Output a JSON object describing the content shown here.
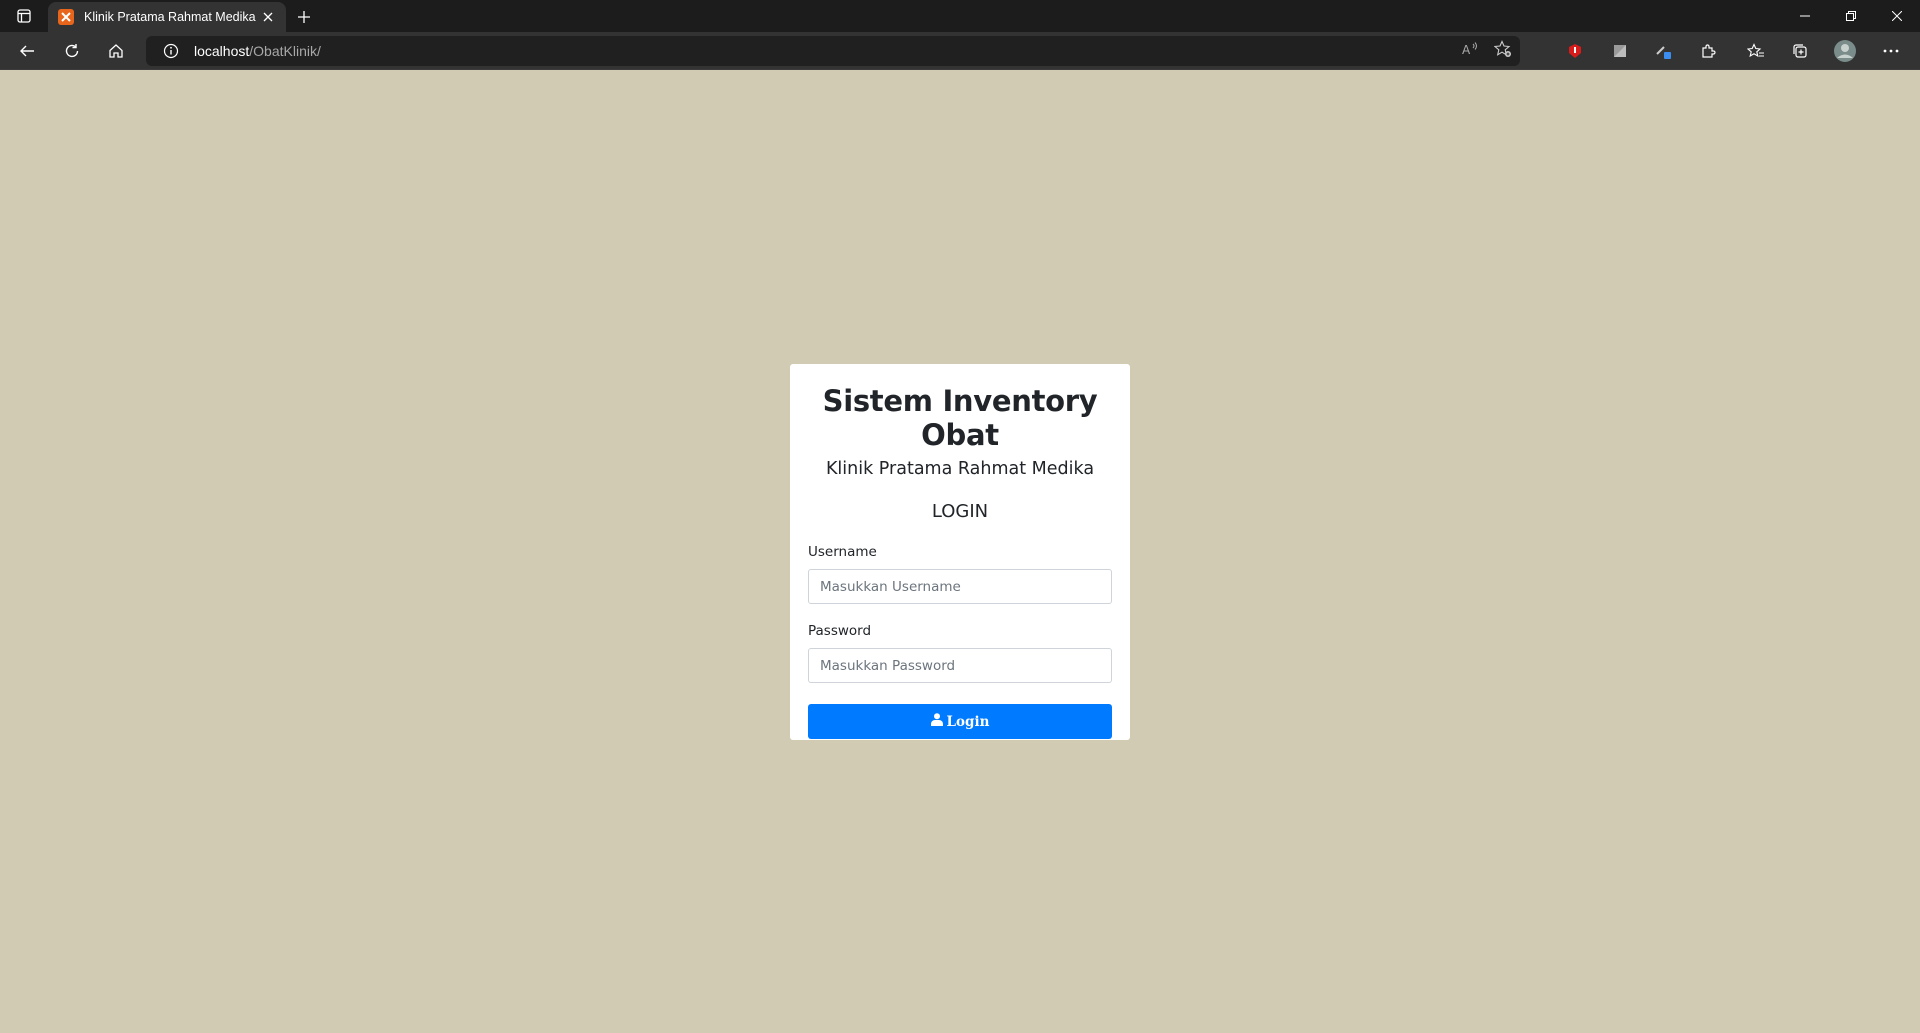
{
  "browser": {
    "tab_title": "Klinik Pratama Rahmat Medika",
    "url_host": "localhost",
    "url_path": "/ObatKlinik/"
  },
  "login": {
    "title": "Sistem Inventory Obat",
    "subtitle": "Klinik Pratama Rahmat Medika",
    "heading": "LOGIN",
    "username_label": "Username",
    "username_placeholder": "Masukkan Username",
    "password_label": "Password",
    "password_placeholder": "Masukkan Password",
    "button_label": "Login"
  },
  "colors": {
    "page_background": "#d2cbb3",
    "button": "#007bff",
    "favicon": "#e8651c"
  }
}
